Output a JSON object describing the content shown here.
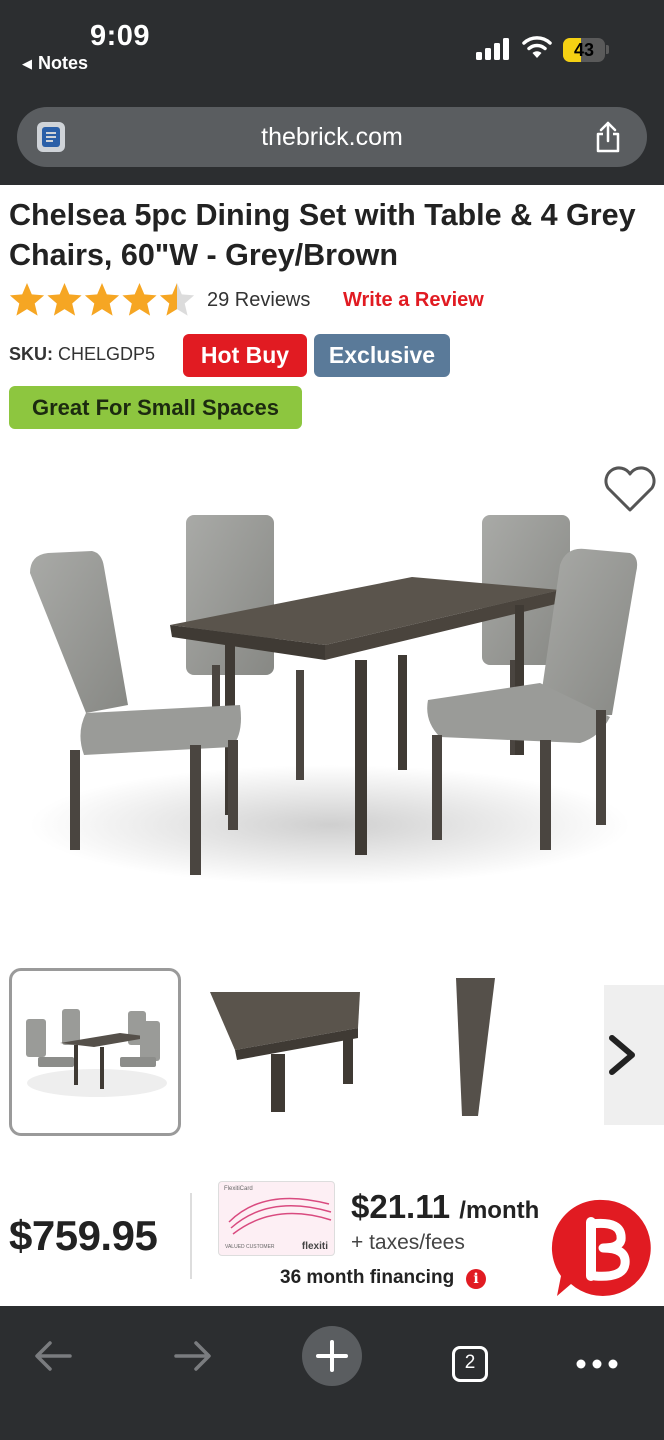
{
  "status_bar": {
    "time": "9:09",
    "back_app": "Notes",
    "battery": "43",
    "battery_level": 0.43
  },
  "browser": {
    "url": "thebrick.com"
  },
  "product": {
    "title": "Chelsea 5pc Dining Set with Table & 4 Grey Chairs, 60\"W - Grey/Brown",
    "rating": 4.5,
    "reviews": "29 Reviews",
    "write_review": "Write a Review",
    "sku_label": "SKU:",
    "sku": "CHELGDP5",
    "badges": {
      "hot_buy": "Hot Buy",
      "exclusive": "Exclusive",
      "small_spaces": "Great For Small Spaces"
    }
  },
  "pricing": {
    "price": "$759.95",
    "monthly": "$21.11",
    "per_month": "/month",
    "taxes": "+ taxes/fees",
    "financing": "36 month financing",
    "card_brand": "flexiti",
    "card_title": "FlexitiCard",
    "card_holder": "VALUED CUSTOMER"
  },
  "toolbar": {
    "tabs_count": "2"
  },
  "colors": {
    "brand_red": "#e11b22",
    "exclusive_blue": "#5a7a99",
    "small_spaces_green": "#8dc63f",
    "star": "#f6a623",
    "chrome_dark": "#2c2e30"
  },
  "icons": {
    "page": "reader-icon",
    "share": "share-icon",
    "wishlist": "heart-icon",
    "next": "chevron-right-icon",
    "info": "info-icon",
    "back": "arrow-left-icon",
    "forward": "arrow-right-icon",
    "new_tab": "plus-icon",
    "tabs": "tabs-icon",
    "more": "more-icon"
  }
}
